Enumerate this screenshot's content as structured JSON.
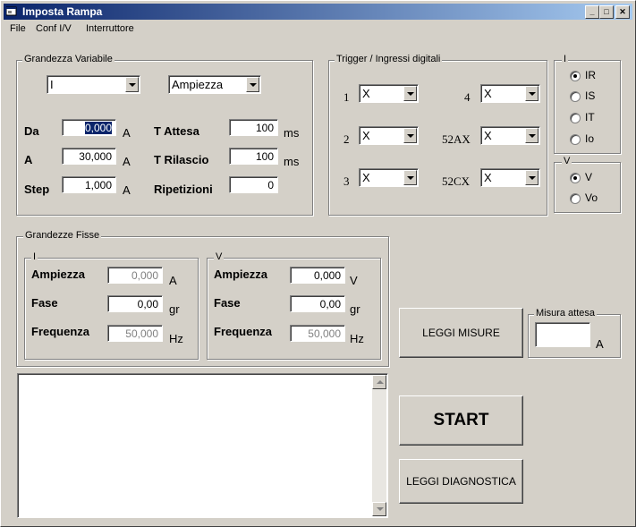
{
  "window": {
    "title": "Imposta Rampa"
  },
  "menu": {
    "file": "File",
    "conf": "Conf I/V",
    "interruttore": "Interruttore"
  },
  "grandezza_variabile": {
    "label": "Grandezza Variabile",
    "combo_left": "I",
    "combo_right": "Ampiezza",
    "da_label": "Da",
    "da_value": "0,000",
    "da_unit": "A",
    "a_label": "A",
    "a_value": "30,000",
    "a_unit": "A",
    "step_label": "Step",
    "step_value": "1,000",
    "step_unit": "A",
    "tattesa_label": "T Attesa",
    "tattesa_value": "100",
    "tattesa_unit": "ms",
    "trilascio_label": "T Rilascio",
    "trilascio_value": "100",
    "trilascio_unit": "ms",
    "ripetizioni_label": "Ripetizioni",
    "ripetizioni_value": "0"
  },
  "trigger": {
    "label": "Trigger / Ingressi digitali",
    "rows": [
      {
        "name": "1",
        "value": "X"
      },
      {
        "name": "2",
        "value": "X"
      },
      {
        "name": "3",
        "value": "X"
      },
      {
        "name": "4",
        "value": "X"
      },
      {
        "name": "52AX",
        "value": "X"
      },
      {
        "name": "52CX",
        "value": "X"
      }
    ]
  },
  "i_group": {
    "label": "I",
    "options": [
      "IR",
      "IS",
      "IT",
      "Io"
    ],
    "selected": "IR"
  },
  "v_group": {
    "label": "V",
    "options": [
      "V",
      "Vo"
    ],
    "selected": "V"
  },
  "grandezze_fisse": {
    "label": "Grandezze Fisse",
    "i": {
      "label": "I",
      "ampiezza_label": "Ampiezza",
      "ampiezza_value": "0,000",
      "ampiezza_unit": "A",
      "fase_label": "Fase",
      "fase_value": "0,00",
      "fase_unit": "gr",
      "freq_label": "Frequenza",
      "freq_value": "50,000",
      "freq_unit": "Hz"
    },
    "v": {
      "label": "V",
      "ampiezza_label": "Ampiezza",
      "ampiezza_value": "0,000",
      "ampiezza_unit": "V",
      "fase_label": "Fase",
      "fase_value": "0,00",
      "fase_unit": "gr",
      "freq_label": "Frequenza",
      "freq_value": "50,000",
      "freq_unit": "Hz"
    }
  },
  "buttons": {
    "leggi_misure": "LEGGI MISURE",
    "start": "START",
    "leggi_diagnostica": "LEGGI DIAGNOSTICA"
  },
  "misura_attesa": {
    "label": "Misura attesa",
    "value": "",
    "unit": "A"
  }
}
